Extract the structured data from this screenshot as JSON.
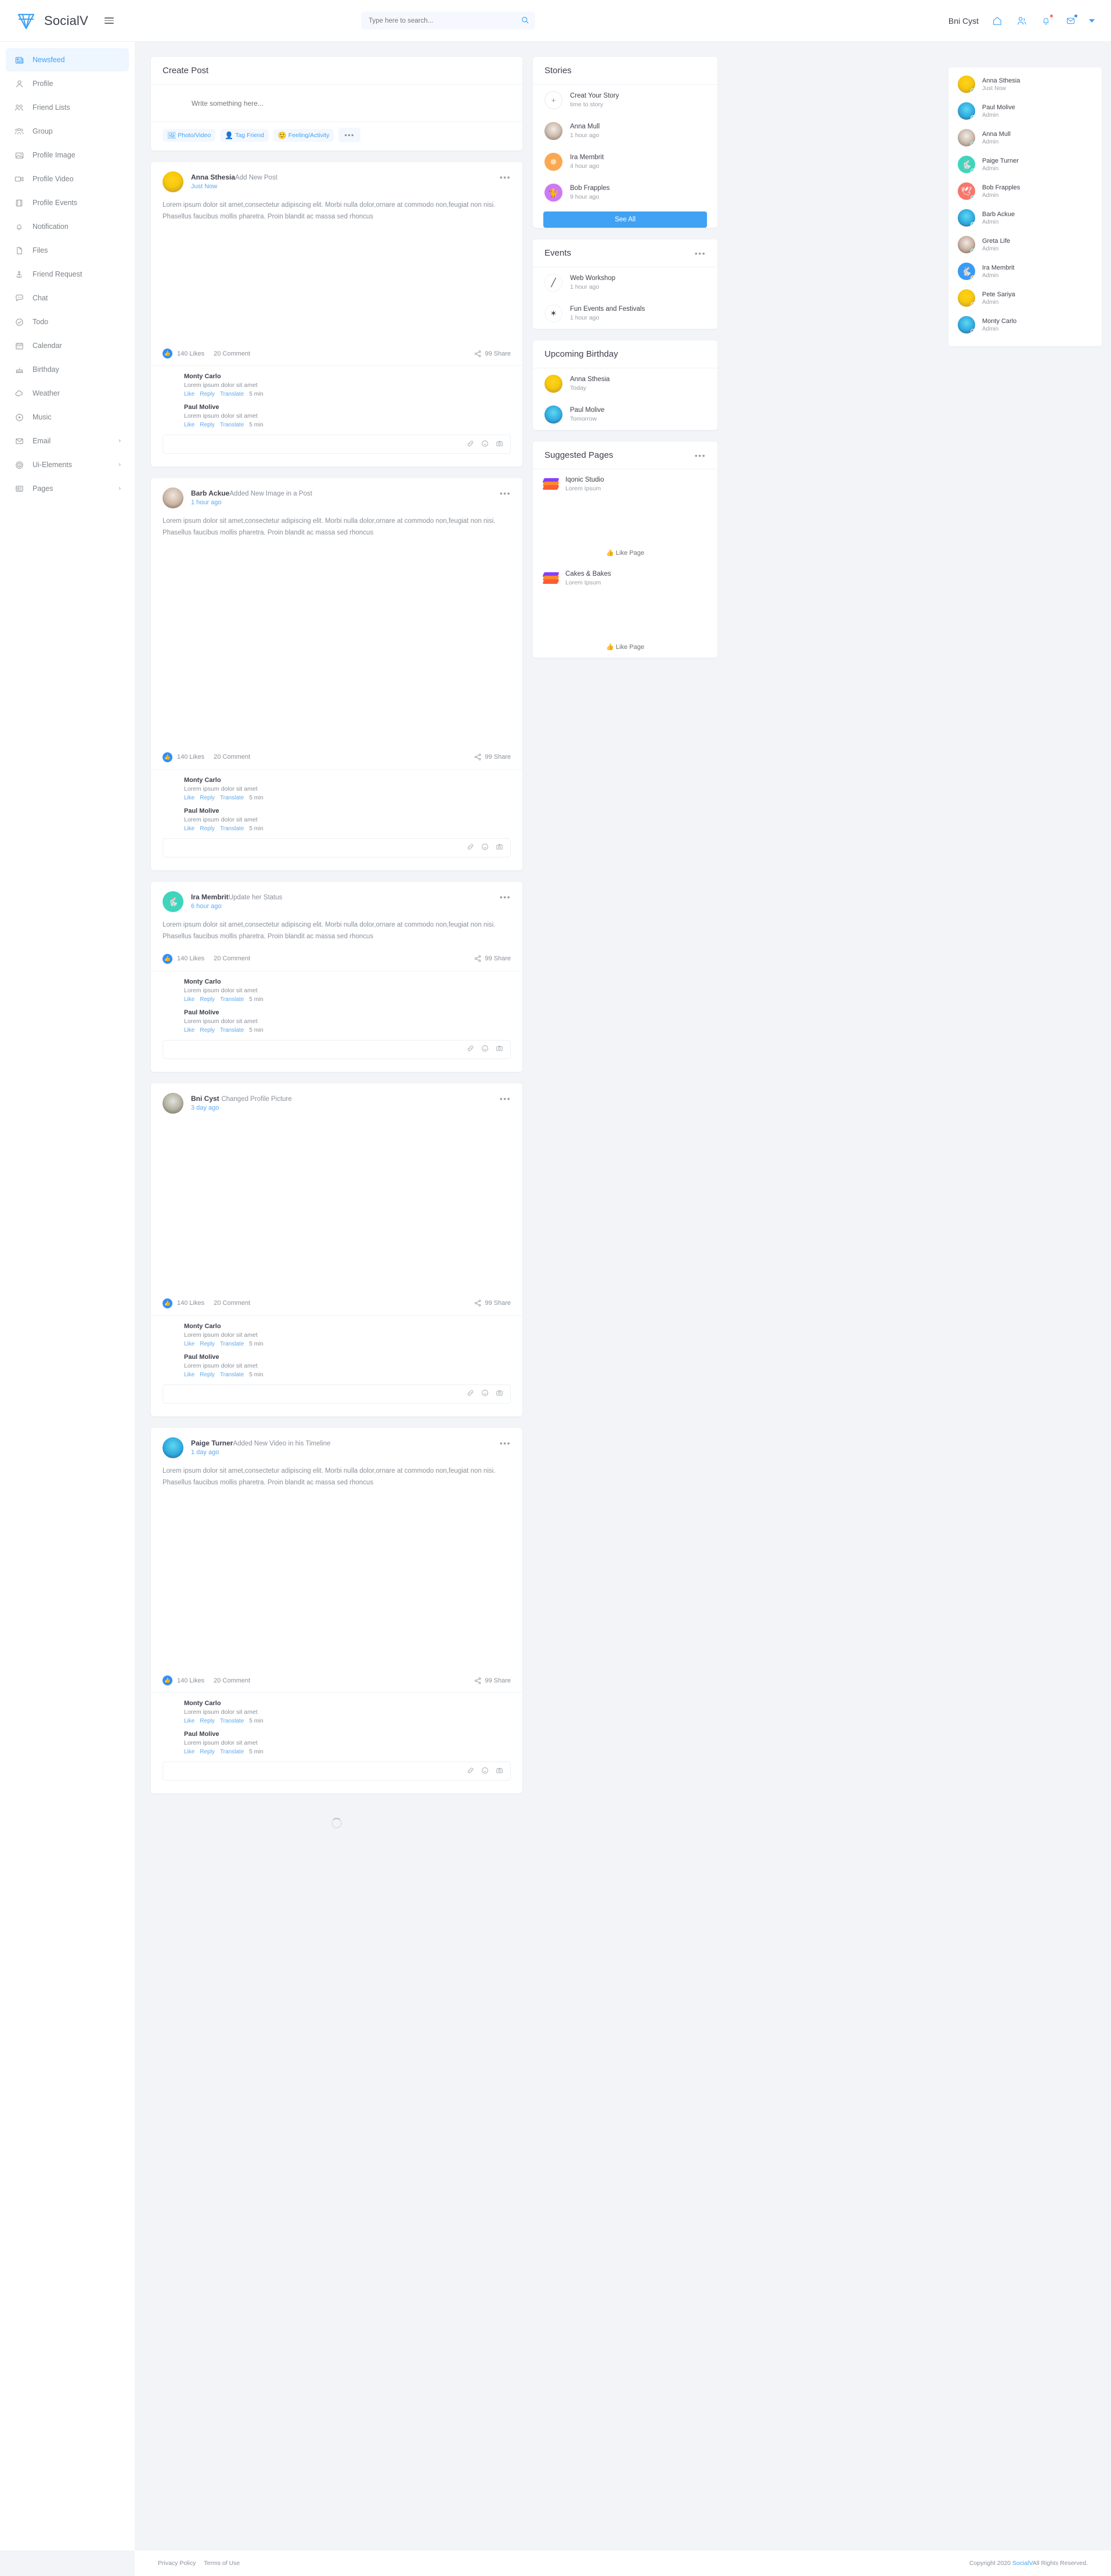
{
  "brand": {
    "name": "SocialV",
    "logo_icon": "socialv-logo-icon"
  },
  "header": {
    "search_placeholder": "Type here to search...",
    "search_value": "",
    "search_icon": "search-icon",
    "user_name": "Bni Cyst",
    "icons": [
      "home-icon",
      "friends-icon",
      "bell-icon",
      "mail-icon",
      "chevron-down-icon"
    ]
  },
  "sidebar": {
    "items": [
      {
        "label": "Newsfeed",
        "icon": "newspaper-icon",
        "active": true
      },
      {
        "label": "Profile",
        "icon": "user-icon",
        "active": false
      },
      {
        "label": "Friend Lists",
        "icon": "users-icon",
        "active": false
      },
      {
        "label": "Group",
        "icon": "group-icon",
        "active": false
      },
      {
        "label": "Profile Image",
        "icon": "image-icon",
        "active": false
      },
      {
        "label": "Profile Video",
        "icon": "video-icon",
        "active": false
      },
      {
        "label": "Profile Events",
        "icon": "film-icon",
        "active": false
      },
      {
        "label": "Notification",
        "icon": "bell-icon",
        "active": false
      },
      {
        "label": "Files",
        "icon": "file-icon",
        "active": false
      },
      {
        "label": "Friend Request",
        "icon": "anchor-icon",
        "active": false
      },
      {
        "label": "Chat",
        "icon": "chat-icon",
        "active": false
      },
      {
        "label": "Todo",
        "icon": "check-circle-icon",
        "active": false
      },
      {
        "label": "Calendar",
        "icon": "calendar-icon",
        "active": false
      },
      {
        "label": "Birthday",
        "icon": "cake-icon",
        "active": false
      },
      {
        "label": "Weather",
        "icon": "cloud-icon",
        "active": false
      },
      {
        "label": "Music",
        "icon": "play-circle-icon",
        "active": false
      },
      {
        "label": "Email",
        "icon": "envelope-icon",
        "active": false,
        "chevron": "›"
      },
      {
        "label": "Ui-Elements",
        "icon": "target-icon",
        "active": false,
        "chevron": "›"
      },
      {
        "label": "Pages",
        "icon": "pages-icon",
        "active": false,
        "chevron": "›"
      }
    ]
  },
  "create_post": {
    "title": "Create Post",
    "placeholder": "Write something here...",
    "value": "",
    "actions": [
      {
        "label": "Photo/Video",
        "icon": "photo-video-icon",
        "glyph": "🖼"
      },
      {
        "label": "Tag Friend",
        "icon": "tag-friend-icon",
        "glyph": "👤"
      },
      {
        "label": "Feeling/Activity",
        "icon": "feeling-activity-icon",
        "glyph": "🙂"
      }
    ],
    "more": "•••"
  },
  "posts": [
    {
      "author": "Anna Sthesia",
      "action": "Add New Post",
      "time": "Just Now",
      "avatar_class": "av-anna",
      "text": "Lorem ipsum dolor sit amet,consectetur adipiscing elit. Morbi nulla dolor,ornare at commodo non,feugiat non nisi. Phasellus faucibus mollis pharetra. Proin blandit ac massa sed rhoncus",
      "media": "grid3",
      "likes": "140 Likes",
      "comments": "20 Comment",
      "shares": "99 Share",
      "comment_list": [
        {
          "name": "Monty Carlo",
          "text": "Lorem ipsum dolor sit amet",
          "time": "5 min",
          "avatar_class": "av-monty"
        },
        {
          "name": "Paul Molive",
          "text": "Lorem ipsum dolor sit amet",
          "time": "5 min",
          "avatar_class": "av-barb"
        }
      ]
    },
    {
      "author": "Barb Ackue",
      "action": "Added New Image in a Post",
      "time": "1 hour ago",
      "avatar_class": "av-barb",
      "text": "Lorem ipsum dolor sit amet,consectetur adipiscing elit. Morbi nulla dolor,ornare at commodo non,feugiat non nisi. Phasellus faucibus mollis pharetra. Proin blandit ac massa sed rhoncus",
      "media": "single",
      "likes": "140 Likes",
      "comments": "20 Comment",
      "shares": "99 Share",
      "comment_list": [
        {
          "name": "Monty Carlo",
          "text": "Lorem ipsum dolor sit amet",
          "time": "5 min",
          "avatar_class": "av-monty"
        },
        {
          "name": "Paul Molive",
          "text": "Lorem ipsum dolor sit amet",
          "time": "5 min",
          "avatar_class": "av-barb"
        }
      ]
    },
    {
      "author": "Ira Membrit",
      "action": "Update her Status",
      "time": "6 hour ago",
      "avatar_class": "av-solid-teal",
      "avatar_glyph": "🐇",
      "text": "Lorem ipsum dolor sit amet,consectetur adipiscing elit. Morbi nulla dolor,ornare at commodo non,feugiat non nisi. Phasellus faucibus mollis pharetra. Proin blandit ac massa sed rhoncus",
      "media": "none",
      "likes": "140 Likes",
      "comments": "20 Comment",
      "shares": "99 Share",
      "comment_list": [
        {
          "name": "Monty Carlo",
          "text": "Lorem ipsum dolor sit amet",
          "time": "5 min",
          "avatar_class": "av-monty"
        },
        {
          "name": "Paul Molive",
          "text": "Lorem ipsum dolor sit amet",
          "time": "5 min",
          "avatar_class": "av-barb"
        }
      ]
    },
    {
      "author": "Bni Cyst",
      "action": "Changed Profile Picture",
      "time": "3 day ago",
      "avatar_class": "av-bni",
      "text": "",
      "media": "wide",
      "likes": "140 Likes",
      "comments": "20 Comment",
      "shares": "99 Share",
      "comment_list": [
        {
          "name": "Monty Carlo",
          "text": "Lorem ipsum dolor sit amet",
          "time": "5 min",
          "avatar_class": "av-monty"
        },
        {
          "name": "Paul Molive",
          "text": "Lorem ipsum dolor sit amet",
          "time": "5 min",
          "avatar_class": "av-barb"
        }
      ]
    },
    {
      "author": "Paige Turner",
      "action": "Added New Video in his Timeline",
      "time": "1 day ago",
      "avatar_class": "av-paul",
      "text": "Lorem ipsum dolor sit amet,consectetur adipiscing elit. Morbi nulla dolor,ornare at commodo non,feugiat non nisi. Phasellus faucibus mollis pharetra. Proin blandit ac massa sed rhoncus",
      "media": "video",
      "likes": "140 Likes",
      "comments": "20 Comment",
      "shares": "99 Share",
      "comment_list": [
        {
          "name": "Monty Carlo",
          "text": "Lorem ipsum dolor sit amet",
          "time": "5 min",
          "avatar_class": "av-monty"
        },
        {
          "name": "Paul Molive",
          "text": "Lorem ipsum dolor sit amet",
          "time": "5 min",
          "avatar_class": "av-barb"
        }
      ]
    }
  ],
  "comment_labels": {
    "like": "Like",
    "reply": "Reply",
    "translate": "Translate"
  },
  "comment_box_icons": [
    "link-icon",
    "emoji-icon",
    "camera-icon"
  ],
  "stories": {
    "title": "Stories",
    "see_all": "See All",
    "items": [
      {
        "name": "Creat Your Story",
        "sub": "time to story",
        "type": "plus"
      },
      {
        "name": "Anna Mull",
        "sub": "1 hour ago",
        "avatar_class": "av-annamull"
      },
      {
        "name": "Ira Membrit",
        "sub": "4 hour ago",
        "avatar_class": "av-solid-orange",
        "glyph": "✵"
      },
      {
        "name": "Bob Frapples",
        "sub": "9 hour ago",
        "avatar_class": "av-solid-purple",
        "glyph": "🐈"
      }
    ]
  },
  "events": {
    "title": "Events",
    "items": [
      {
        "name": "Web Workshop",
        "sub": "1 hour ago",
        "glyph": "╱"
      },
      {
        "name": "Fun Events and Festivals",
        "sub": "1 hour ago",
        "glyph": "✶"
      }
    ]
  },
  "birthday": {
    "title": "Upcoming Birthday",
    "items": [
      {
        "name": "Anna Sthesia",
        "sub": "Today",
        "avatar_class": "av-anna"
      },
      {
        "name": "Paul Molive",
        "sub": "Tomorrow",
        "avatar_class": "av-paul"
      }
    ]
  },
  "suggested_pages": {
    "title": "Suggested Pages",
    "like_label": "Like Page",
    "items": [
      {
        "name": "Iqonic Studio",
        "sub": "Lorem Ipsum",
        "thumb_class": "ph-desk"
      },
      {
        "name": "Cakes & Bakes",
        "sub": "Lorem Ipsum",
        "thumb_class": "ph-cake"
      }
    ]
  },
  "friends": {
    "items": [
      {
        "name": "Anna Sthesia",
        "sub": "Just Now",
        "avatar_class": "av-anna",
        "status": "#3fd5bd"
      },
      {
        "name": "Paul Molive",
        "sub": "Admin",
        "avatar_class": "av-paul",
        "status": "#3fd5bd"
      },
      {
        "name": "Anna Mull",
        "sub": "Admin",
        "avatar_class": "av-annamull",
        "status": "#3fd5bd"
      },
      {
        "name": "Paige Turner",
        "sub": "Admin",
        "avatar_class": "av-solid-teal",
        "glyph": "🐇",
        "status": "#3fd5bd"
      },
      {
        "name": "Bob Frapples",
        "sub": "Admin",
        "avatar_class": "av-solid-red",
        "glyph": "🕊",
        "status": "#3fd5bd"
      },
      {
        "name": "Barb Ackue",
        "sub": "Admin",
        "avatar_class": "av-monty",
        "status": "#3fd5bd"
      },
      {
        "name": "Greta Life",
        "sub": "Admin",
        "avatar_class": "av-greta",
        "status": "#3fd5bd"
      },
      {
        "name": "Ira Membrit",
        "sub": "Admin",
        "avatar_class": "av-solid-blue",
        "glyph": "🐇",
        "status": "#f9a952"
      },
      {
        "name": "Pete Sariya",
        "sub": "Admin",
        "avatar_class": "av-anna",
        "status": "#f9a952"
      },
      {
        "name": "Monty Carlo",
        "sub": "Admin",
        "avatar_class": "av-monty",
        "status": "#7b8086"
      }
    ]
  },
  "footer": {
    "privacy": "Privacy Policy",
    "terms": "Terms of Use",
    "copy_prefix": "Copyright 2020 ",
    "copy_link": "SocialV",
    "copy_suffix": "All Rights Reserved."
  },
  "colors": {
    "accent": "#41a2f4",
    "like_blue": "#2f8fff",
    "online": "#3fd5bd",
    "away": "#f9a952",
    "offline": "#7b8086"
  }
}
